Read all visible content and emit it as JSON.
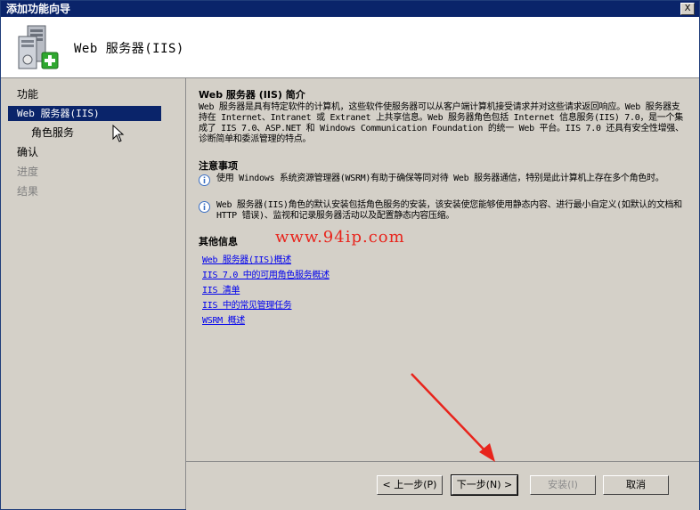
{
  "window": {
    "title": "添加功能向导",
    "close_glyph": "X"
  },
  "header": {
    "title": "Web 服务器(IIS)",
    "icon": "server-add-icon"
  },
  "sidebar": {
    "items": [
      {
        "label": "功能",
        "state": "normal"
      },
      {
        "label": "Web 服务器(IIS)",
        "state": "selected"
      },
      {
        "label": "角色服务",
        "state": "normal"
      },
      {
        "label": "确认",
        "state": "normal"
      },
      {
        "label": "进度",
        "state": "disabled"
      },
      {
        "label": "结果",
        "state": "disabled"
      }
    ]
  },
  "content": {
    "intro_title": "Web 服务器 (IIS) 简介",
    "intro_text": "Web 服务器是具有特定软件的计算机，这些软件使服务器可以从客户端计算机接受请求并对这些请求返回响应。Web 服务器支持在 Internet、Intranet 或 Extranet 上共享信息。Web 服务器角色包括 Internet 信息服务(IIS) 7.0，是一个集成了 IIS 7.0、ASP.NET 和 Windows Communication Foundation 的统一 Web 平台。IIS 7.0 还具有安全性增强、诊断简单和委派管理的特点。",
    "notes_title": "注意事项",
    "notes": [
      "使用 Windows 系统资源管理器(WSRM)有助于确保等同对待 Web 服务器通信，特别是此计算机上存在多个角色时。",
      "Web 服务器(IIS)角色的默认安装包括角色服务的安装，该安装使您能够使用静态内容、进行最小自定义(如默认的文档和 HTTP 错误)、监视和记录服务器活动以及配置静态内容压缩。"
    ],
    "more_title": "其他信息",
    "watermark": "www.94ip.com",
    "links": [
      "Web 服务器(IIS)概述",
      "IIS 7.0 中的可用角色服务概述",
      "IIS 清单",
      "IIS 中的常见管理任务",
      "WSRM 概述"
    ]
  },
  "footer": {
    "back_label": "< 上一步(P)",
    "next_label": "下一步(N) >",
    "install_label": "安装(I)",
    "cancel_label": "取消"
  },
  "colors": {
    "title_bar": "#0a246a",
    "selection": "#0a246a",
    "dialog_bg": "#d4d0c8",
    "link": "#0000ee",
    "watermark": "#e8241c",
    "arrow": "#e8241c"
  }
}
